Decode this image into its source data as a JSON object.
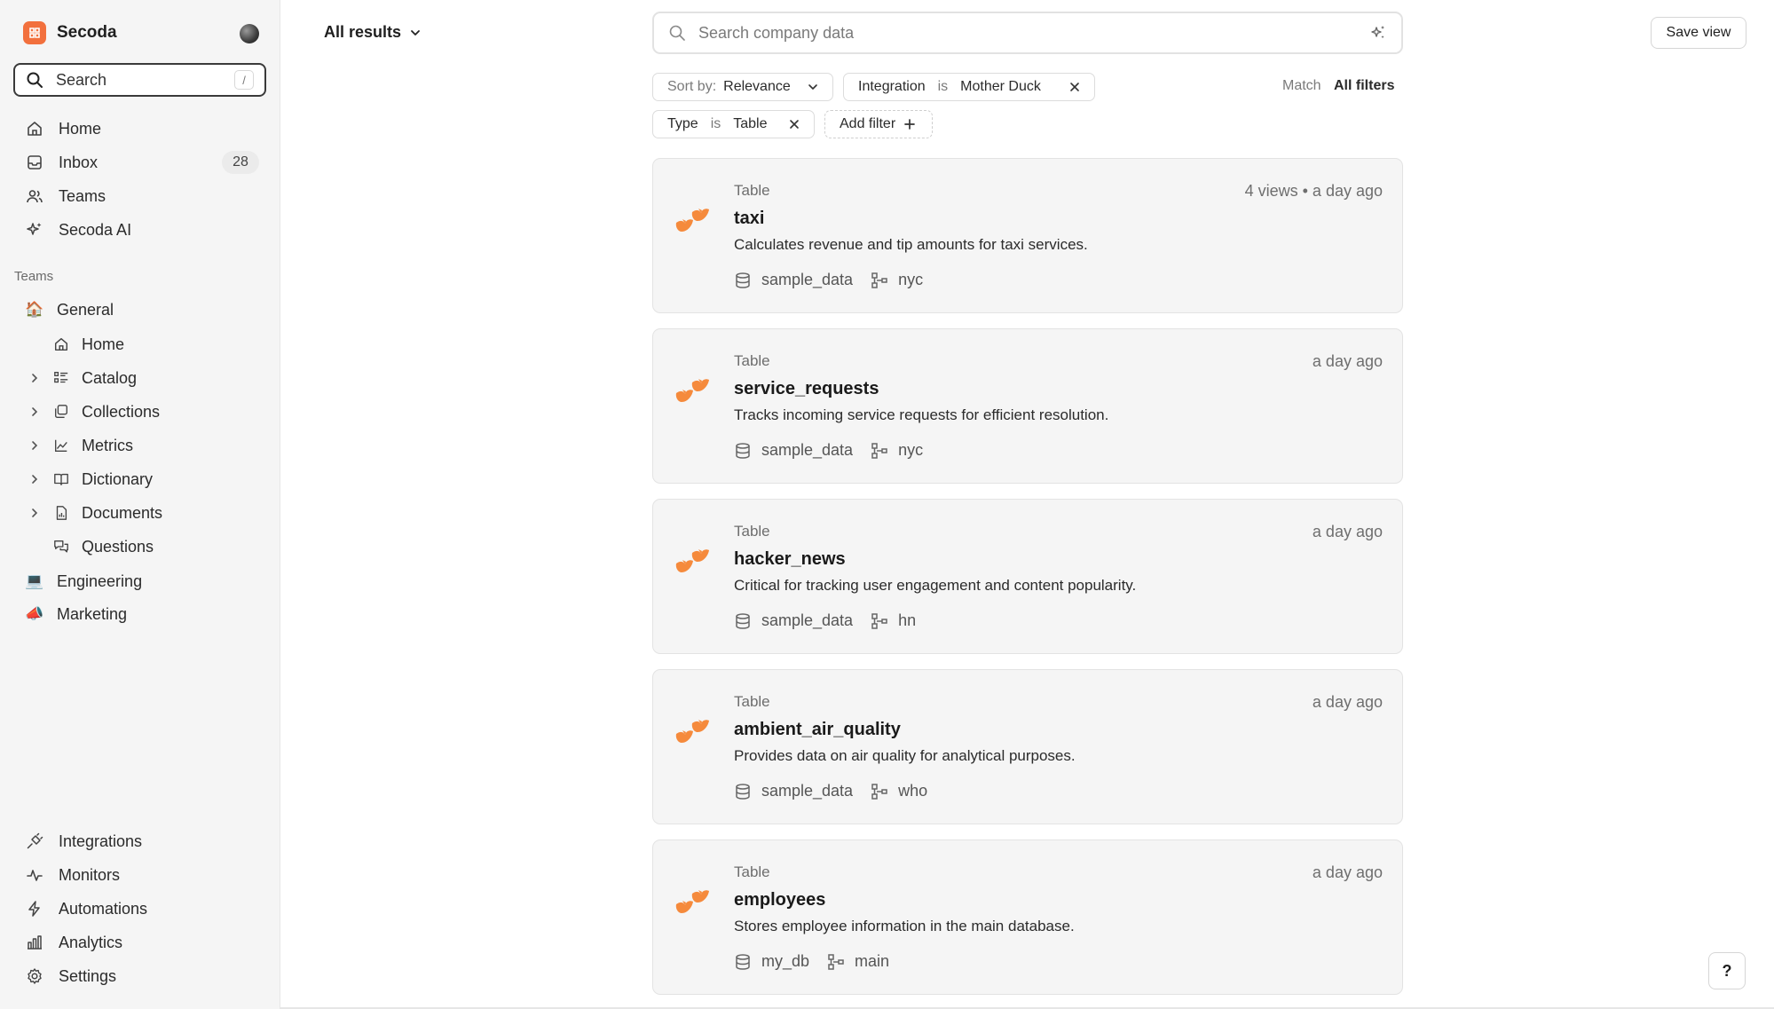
{
  "sidebar": {
    "brand": "Secoda",
    "search": {
      "label": "Search",
      "shortcut": "/"
    },
    "nav": [
      {
        "label": "Home",
        "icon": "home-icon"
      },
      {
        "label": "Inbox",
        "icon": "inbox-icon",
        "badge": "28"
      },
      {
        "label": "Teams",
        "icon": "users-icon"
      },
      {
        "label": "Secoda AI",
        "icon": "sparkles-icon"
      }
    ],
    "teams_heading": "Teams",
    "teams": [
      {
        "label": "General",
        "icon": "house-emoji"
      },
      {
        "label": "Engineering",
        "icon": "laptop-emoji"
      },
      {
        "label": "Marketing",
        "icon": "megaphone-emoji"
      }
    ],
    "general_children": [
      {
        "label": "Home",
        "icon": "home-icon",
        "expandable": false
      },
      {
        "label": "Catalog",
        "icon": "catalog-icon",
        "expandable": true
      },
      {
        "label": "Collections",
        "icon": "collections-icon",
        "expandable": true
      },
      {
        "label": "Metrics",
        "icon": "metrics-icon",
        "expandable": true
      },
      {
        "label": "Dictionary",
        "icon": "book-icon",
        "expandable": true
      },
      {
        "label": "Documents",
        "icon": "document-icon",
        "expandable": true
      },
      {
        "label": "Questions",
        "icon": "questions-icon",
        "expandable": false
      }
    ],
    "bottom_nav": [
      {
        "label": "Integrations",
        "icon": "plug-icon"
      },
      {
        "label": "Monitors",
        "icon": "pulse-icon"
      },
      {
        "label": "Automations",
        "icon": "lightning-icon"
      },
      {
        "label": "Analytics",
        "icon": "bar-chart-icon"
      },
      {
        "label": "Settings",
        "icon": "gear-icon"
      }
    ]
  },
  "header": {
    "view_selector": "All results",
    "search_placeholder": "Search company data",
    "save_view": "Save view"
  },
  "filters": {
    "sort": {
      "label": "Sort by:",
      "value": "Relevance"
    },
    "integration": {
      "field": "Integration",
      "op": "is",
      "value": "Mother Duck"
    },
    "type": {
      "field": "Type",
      "op": "is",
      "value": "Table"
    },
    "add_filter": "Add filter",
    "match_label": "Match",
    "match_value": "All filters"
  },
  "results": [
    {
      "type": "Table",
      "title": "taxi",
      "description": "Calculates revenue and tip amounts for taxi services.",
      "meta": "4 views • a day ago",
      "database": "sample_data",
      "schema": "nyc"
    },
    {
      "type": "Table",
      "title": "service_requests",
      "description": "Tracks incoming service requests for efficient resolution.",
      "meta": "a day ago",
      "database": "sample_data",
      "schema": "nyc"
    },
    {
      "type": "Table",
      "title": "hacker_news",
      "description": "Critical for tracking user engagement and content popularity.",
      "meta": "a day ago",
      "database": "sample_data",
      "schema": "hn"
    },
    {
      "type": "Table",
      "title": "ambient_air_quality",
      "description": "Provides data on air quality for analytical purposes.",
      "meta": "a day ago",
      "database": "sample_data",
      "schema": "who"
    },
    {
      "type": "Table",
      "title": "employees",
      "description": "Stores employee information in the main database.",
      "meta": "a day ago",
      "database": "my_db",
      "schema": "main"
    }
  ],
  "help": "?",
  "colors": {
    "accent": "#f2703d",
    "duck": "#f58a3c",
    "sidebar_bg": "#f5f5f5",
    "card_bg": "#f5f5f5"
  }
}
